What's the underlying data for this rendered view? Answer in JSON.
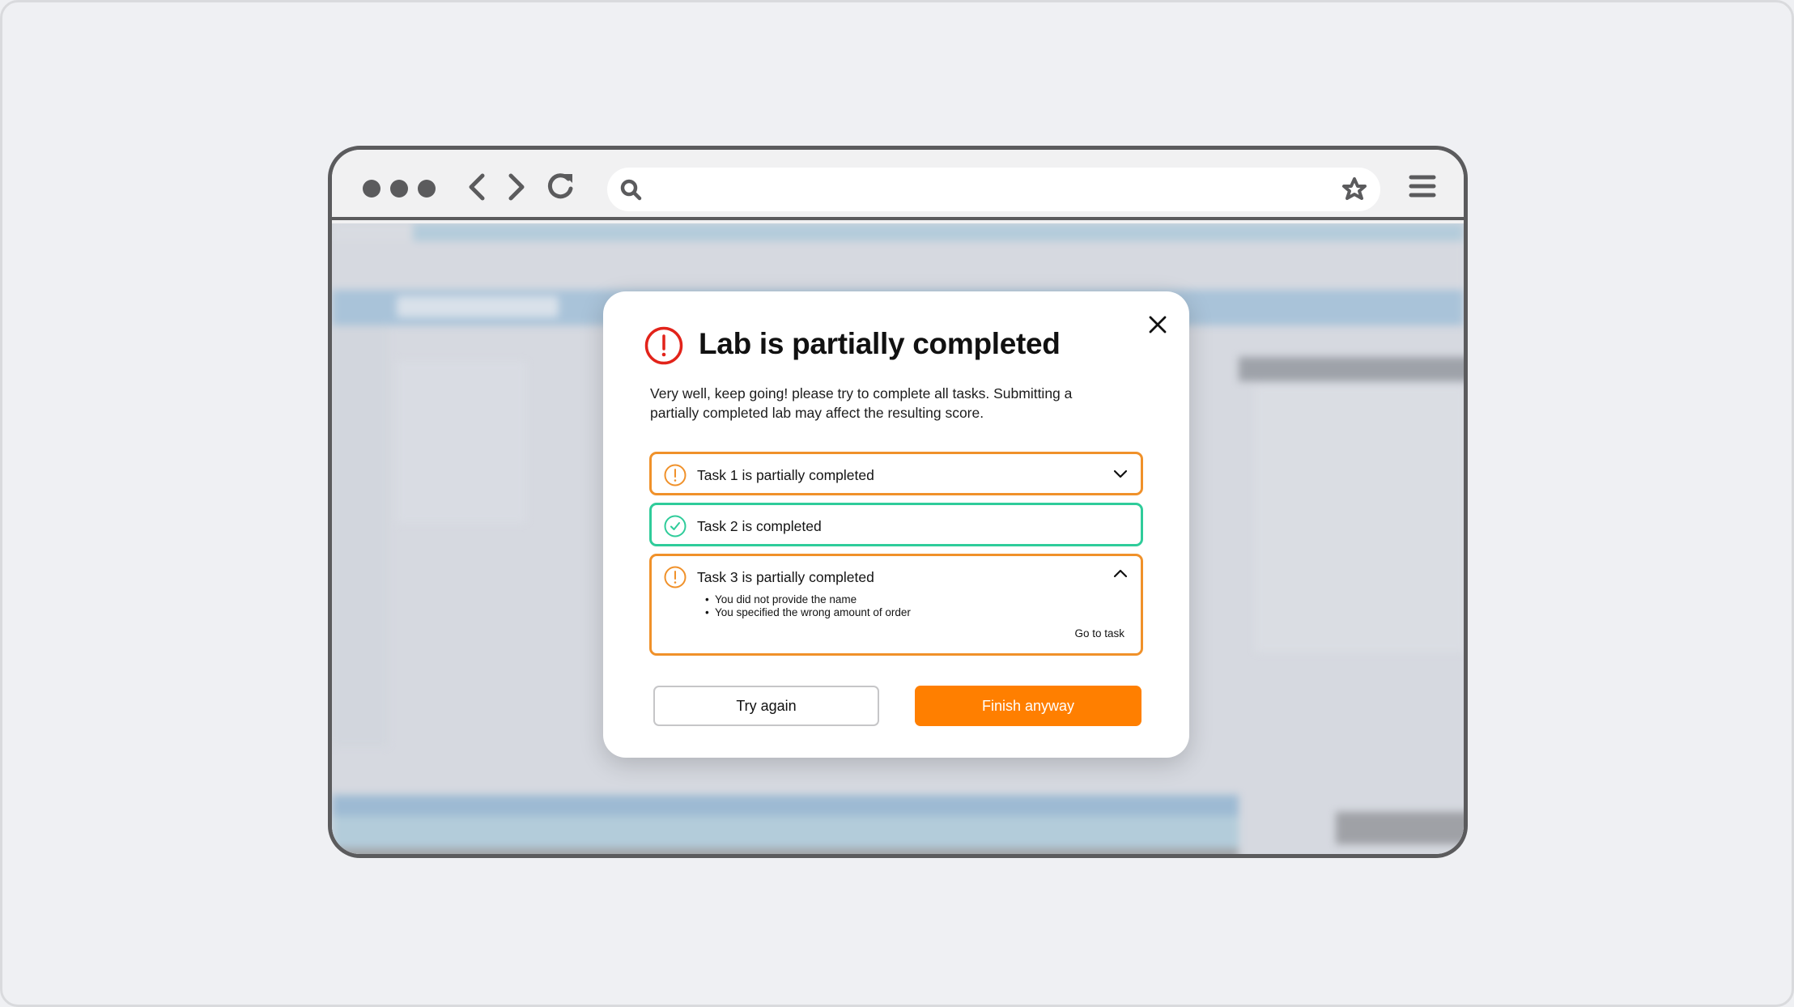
{
  "browser": {
    "window_dots": [
      "dot",
      "dot",
      "dot"
    ],
    "icons": {
      "back": "chevron-left-icon",
      "forward": "chevron-right-icon",
      "reload": "reload-icon",
      "search": "search-icon",
      "bookmark": "star-icon",
      "menu": "hamburger-menu-icon"
    },
    "url": ""
  },
  "modal": {
    "title": "Lab is partially completed",
    "description": "Very well, keep going! please try to complete all tasks. Submitting a partially completed lab may affect the resulting score.",
    "close_icon": "close-icon",
    "tasks": [
      {
        "label": "Task 1 is partially completed",
        "status": "partial",
        "expanded": false
      },
      {
        "label": "Task 2 is completed",
        "status": "completed"
      },
      {
        "label": "Task 3 is partially completed",
        "status": "partial",
        "expanded": true,
        "issues": [
          "You did not provide the name",
          "You specified the wrong amount of order"
        ],
        "link": "Go to task"
      }
    ],
    "buttons": {
      "try_again": "Try again",
      "finish_anyway": "Finish anyway"
    }
  },
  "colors": {
    "error_red": "#e2231a",
    "warning_orange": "#f0912a",
    "success_green": "#2fcc9a",
    "primary_orange": "#ff7f00",
    "chrome_gray": "#5b5b5d"
  }
}
